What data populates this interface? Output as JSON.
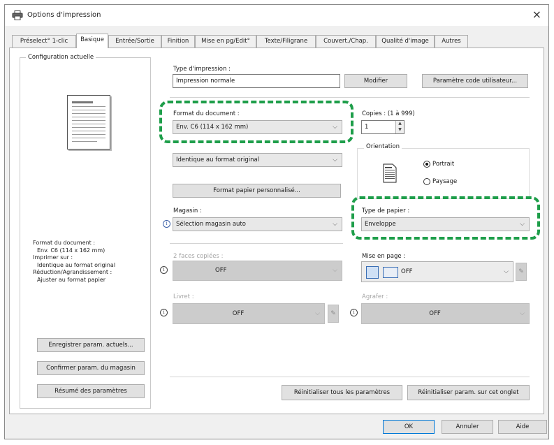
{
  "window": {
    "title": "Options d'impression",
    "close_glyph": "×",
    "title_icon": "printer-icon"
  },
  "tabs": [
    {
      "label": "Préselect° 1-clic"
    },
    {
      "label": "Basique"
    },
    {
      "label": "Entrée/Sortie"
    },
    {
      "label": "Finition"
    },
    {
      "label": "Mise en pg/Edit°"
    },
    {
      "label": "Texte/Filigrane"
    },
    {
      "label": "Couvert./Chap."
    },
    {
      "label": "Qualité d'image"
    },
    {
      "label": "Autres"
    }
  ],
  "current_config": {
    "title": "Configuration actuelle",
    "summary": [
      "Format du document :",
      "Env. C6 (114 x 162 mm)",
      "Imprimer sur :",
      "Identique au format original",
      "Réduction/Agrandissement :",
      "Ajuster au format papier"
    ],
    "buttons": {
      "save": "Enregistrer param. actuels...",
      "confirm": "Confirmer param. du magasin",
      "summary": "Résumé des paramètres"
    }
  },
  "print_type": {
    "label": "Type d'impression :",
    "value": "Impression normale",
    "modify": "Modifier",
    "user_code": "Paramètre code utilisateur..."
  },
  "document_format": {
    "label": "Format du document :",
    "value": "Env. C6 (114 x 162 mm)"
  },
  "print_on": {
    "value": "Identique au format original"
  },
  "custom_paper_button": "Format papier personnalisé...",
  "copies": {
    "label": "Copies : (1 à 999)",
    "value": "1"
  },
  "orientation": {
    "label": "Orientation",
    "portrait": "Portrait",
    "landscape": "Paysage"
  },
  "tray": {
    "label": "Magasin :",
    "value": "Sélection magasin auto"
  },
  "paper_type": {
    "label": "Type de papier :",
    "value": "Enveloppe"
  },
  "duplex": {
    "label": "2 faces copiées :",
    "value": "OFF"
  },
  "layout": {
    "label": "Mise en page :",
    "value": "OFF"
  },
  "booklet": {
    "label": "Livret :",
    "value": "OFF"
  },
  "staple": {
    "label": "Agrafer :",
    "value": "OFF"
  },
  "reset": {
    "all": "Réinitialiser tous les paramètres",
    "tab": "Réinitialiser param. sur cet onglet"
  },
  "footer": {
    "ok": "OK",
    "cancel": "Annuler",
    "help": "Aide"
  },
  "colors": {
    "highlight": "#1e9e4a",
    "default_button": "#0078d7",
    "disabled": "#cccccc"
  }
}
